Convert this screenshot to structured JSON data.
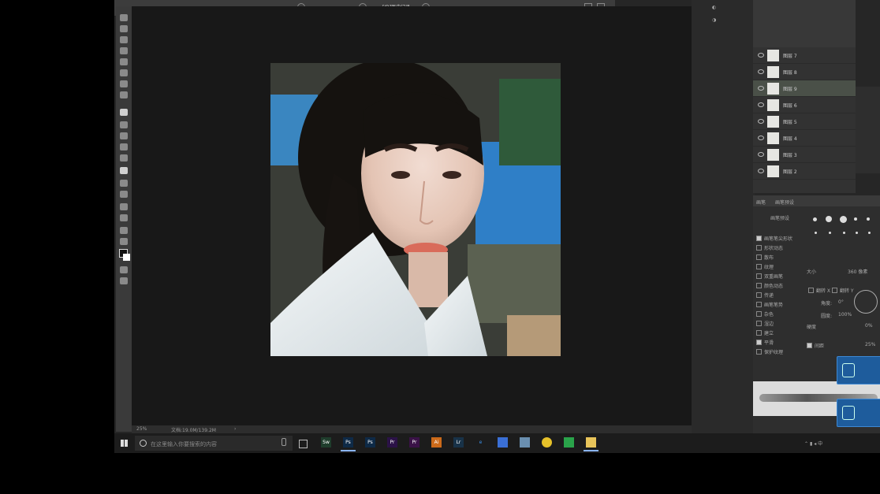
{
  "optionsbar": {
    "history_label": "[ID]历史记录"
  },
  "status": {
    "zoom": "25%",
    "doc": "文档:19.0M/139.2M",
    "arrow": "›"
  },
  "layers": [
    {
      "name": "图层 7"
    },
    {
      "name": "图层 8"
    },
    {
      "name": "图层 9",
      "selected": true
    },
    {
      "name": "图层 6"
    },
    {
      "name": "图层 5"
    },
    {
      "name": "图层 4"
    },
    {
      "name": "图层 3"
    },
    {
      "name": "图层 2"
    }
  ],
  "brush_panel": {
    "tabs": [
      "画笔",
      "画笔预设"
    ],
    "preset_button": "画笔预设",
    "options": [
      {
        "label": "画笔笔尖形状",
        "checked": true
      },
      {
        "label": "形状动态",
        "checked": false
      },
      {
        "label": "散布",
        "checked": false
      },
      {
        "label": "纹理",
        "checked": false
      },
      {
        "label": "双重画笔",
        "checked": false
      },
      {
        "label": "颜色动态",
        "checked": false
      },
      {
        "label": "传递",
        "checked": false
      },
      {
        "label": "画笔笔势",
        "checked": false
      },
      {
        "label": "杂色",
        "checked": false
      },
      {
        "label": "湿边",
        "checked": false
      },
      {
        "label": "建立",
        "checked": false
      },
      {
        "label": "平滑",
        "checked": true
      },
      {
        "label": "保护纹理",
        "checked": false
      }
    ],
    "size_label": "大小",
    "size_value": "360 像素",
    "flip_x": "翻转 X",
    "flip_y": "翻转 Y",
    "angle_label": "角度:",
    "angle_value": "0°",
    "round_label": "圆度:",
    "round_value": "100%",
    "hardness_label": "硬度",
    "hardness_value": "0%",
    "spacing_label": "间距",
    "spacing_value": "25%"
  },
  "taskbar": {
    "search_placeholder": "在这里输入你要搜索的内容",
    "apps": [
      "Sw",
      "Ps",
      "Ps",
      "Pr",
      "Pr",
      "Ai",
      "Lr",
      "e",
      "",
      "",
      "",
      "",
      ""
    ],
    "ime": "中"
  }
}
